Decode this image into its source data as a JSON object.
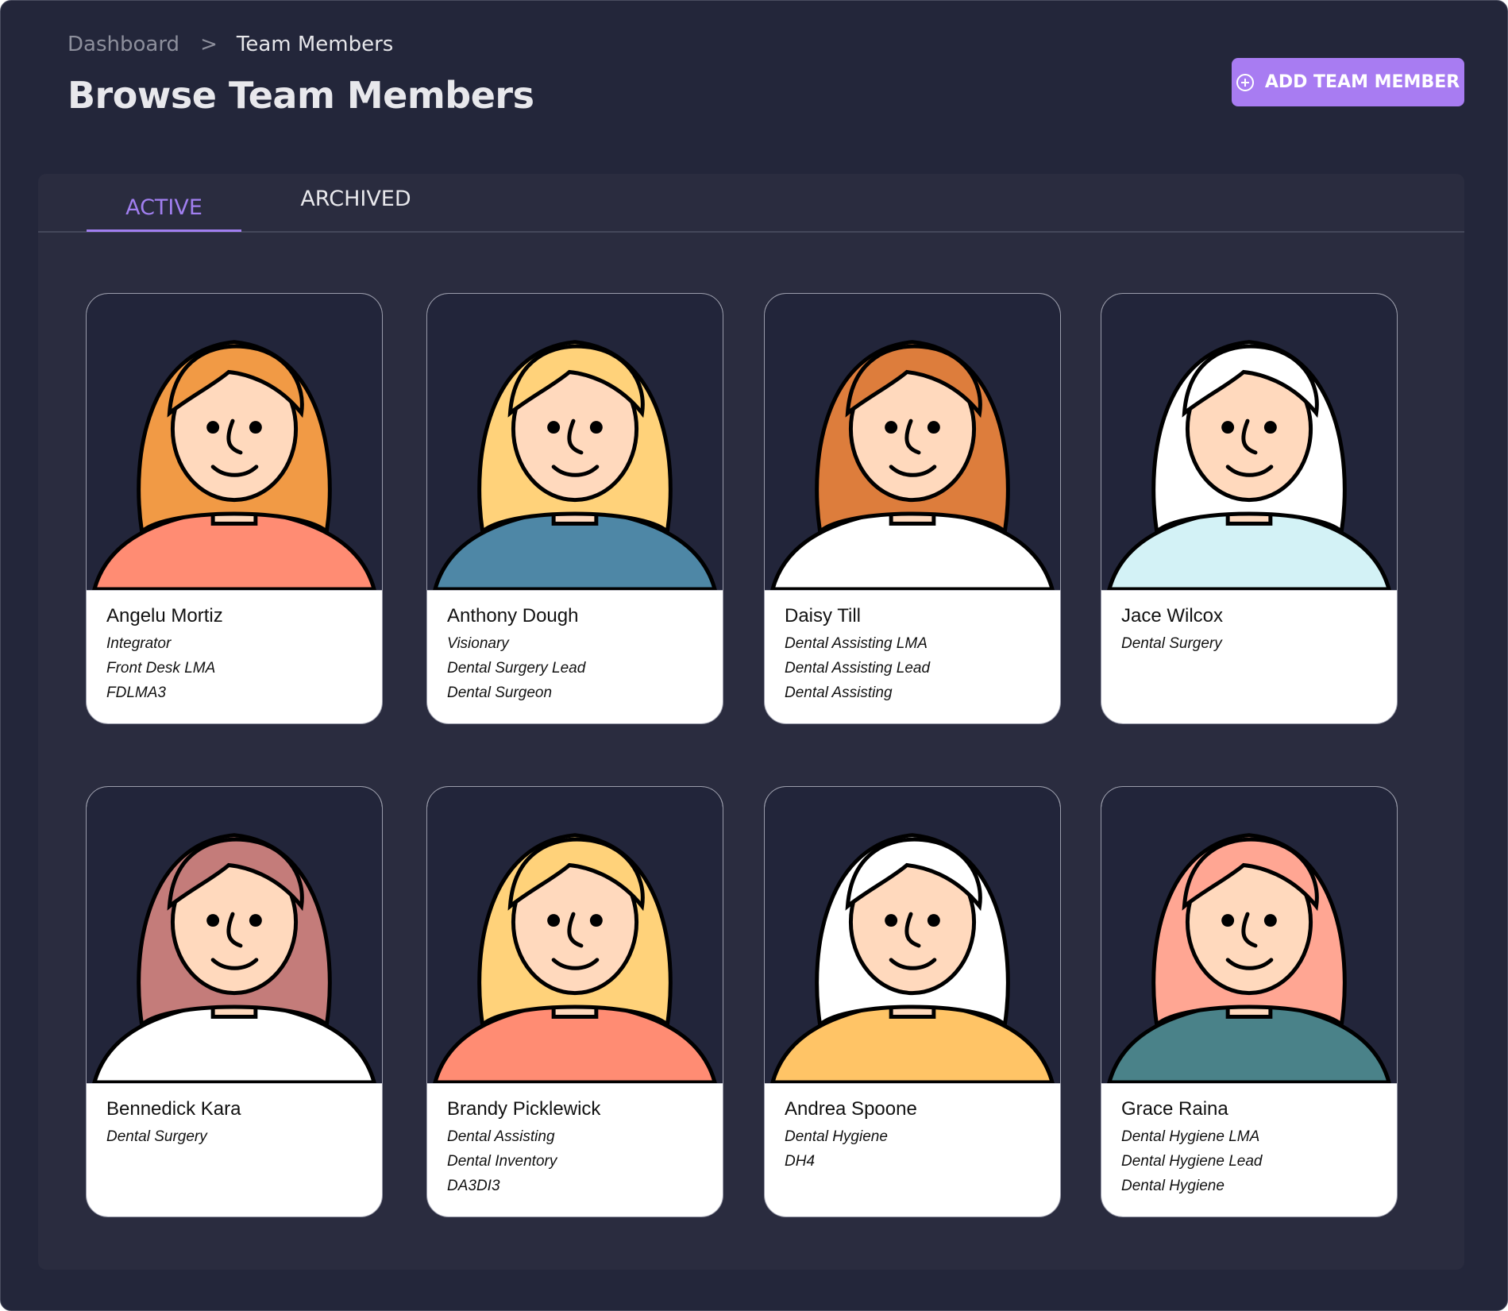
{
  "breadcrumb": {
    "parent": "Dashboard",
    "separator": ">",
    "current": "Team Members"
  },
  "page_title": "Browse Team Members",
  "add_button_label": "ADD TEAM MEMBER",
  "tabs": [
    {
      "label": "ACTIVE",
      "active": true
    },
    {
      "label": "ARCHIVED",
      "active": false
    }
  ],
  "colors": {
    "background": "#23263a",
    "panel": "#2a2c3f",
    "accent": "#a87cf2"
  },
  "members": [
    {
      "name": "Angelu Mortiz",
      "roles": [
        "Integrator",
        "Front Desk LMA",
        "FDLMA3"
      ],
      "hair": "#f19a45",
      "shirt": "#ff8c73",
      "skin": "#ffd9bd"
    },
    {
      "name": "Anthony Dough",
      "roles": [
        "Visionary",
        "Dental Surgery Lead",
        "Dental Surgeon"
      ],
      "hair": "#ffd27a",
      "shirt": "#4e87a6",
      "skin": "#ffd9bd"
    },
    {
      "name": "Daisy Till",
      "roles": [
        "Dental Assisting LMA",
        "Dental Assisting Lead",
        "Dental Assisting"
      ],
      "hair": "#dd7d3c",
      "shirt": "#ffffff",
      "skin": "#ffd9bd"
    },
    {
      "name": "Jace Wilcox",
      "roles": [
        "Dental Surgery"
      ],
      "hair": "#ffffff",
      "shirt": "#d3f2f6",
      "skin": "#ffd9bd"
    },
    {
      "name": "Bennedick Kara",
      "roles": [
        "Dental Surgery"
      ],
      "hair": "#c47c7a",
      "shirt": "#ffffff",
      "skin": "#ffd9bd"
    },
    {
      "name": "Brandy Picklewick",
      "roles": [
        "Dental Assisting",
        "Dental Inventory",
        "DA3DI3"
      ],
      "hair": "#ffd27a",
      "shirt": "#ff8c73",
      "skin": "#ffd9bd"
    },
    {
      "name": "Andrea Spoone",
      "roles": [
        "Dental Hygiene",
        "DH4"
      ],
      "hair": "#ffffff",
      "shirt": "#ffc466",
      "skin": "#ffd9bd"
    },
    {
      "name": "Grace Raina",
      "roles": [
        "Dental Hygiene LMA",
        "Dental Hygiene Lead",
        "Dental Hygiene"
      ],
      "hair": "#ffa693",
      "shirt": "#4a8289",
      "skin": "#ffd9bd"
    }
  ]
}
